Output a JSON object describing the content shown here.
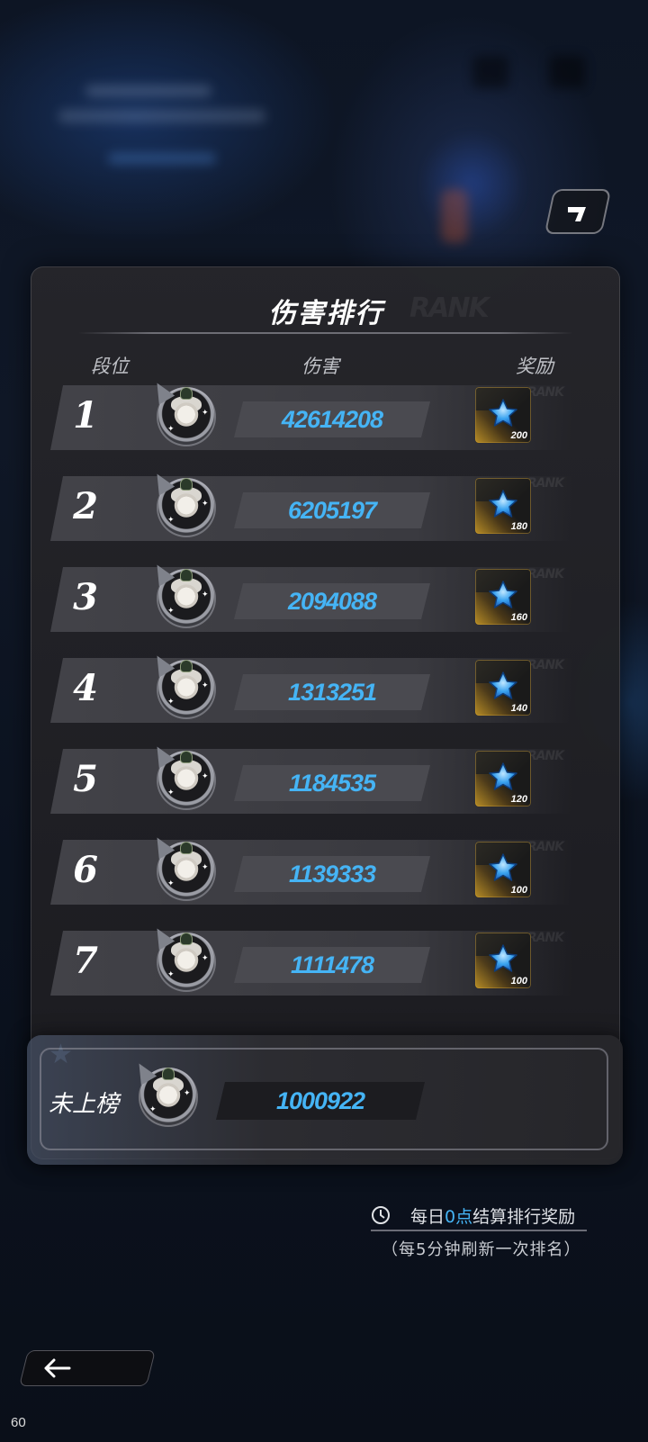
{
  "panel": {
    "title": "伤害排行",
    "headers": {
      "rank": "段位",
      "damage": "伤害",
      "reward": "奖励"
    }
  },
  "rows": [
    {
      "rank": "1",
      "damage": "42614208",
      "reward_qty": "200"
    },
    {
      "rank": "2",
      "damage": "6205197",
      "reward_qty": "180"
    },
    {
      "rank": "3",
      "damage": "2094088",
      "reward_qty": "160"
    },
    {
      "rank": "4",
      "damage": "1313251",
      "reward_qty": "140"
    },
    {
      "rank": "5",
      "damage": "1184535",
      "reward_qty": "120"
    },
    {
      "rank": "6",
      "damage": "1139333",
      "reward_qty": "100"
    },
    {
      "rank": "7",
      "damage": "1111478",
      "reward_qty": "100"
    }
  ],
  "my_rank": {
    "label": "未上榜",
    "damage": "1000922"
  },
  "footer": {
    "settle_prefix": "每日",
    "settle_highlight": "0点",
    "settle_suffix": "结算排行奖励",
    "refresh_note": "（每5分钟刷新一次排名）"
  },
  "fps_counter": "60",
  "colors": {
    "damage_value": "#45b4f5",
    "accent": "#45b4f5",
    "reward_gold": "#d2a028"
  },
  "icons": {
    "reward": "blue-star-icon",
    "back": "arrow-left-icon",
    "clock": "clock-icon",
    "return": "return-arrow-icon"
  }
}
